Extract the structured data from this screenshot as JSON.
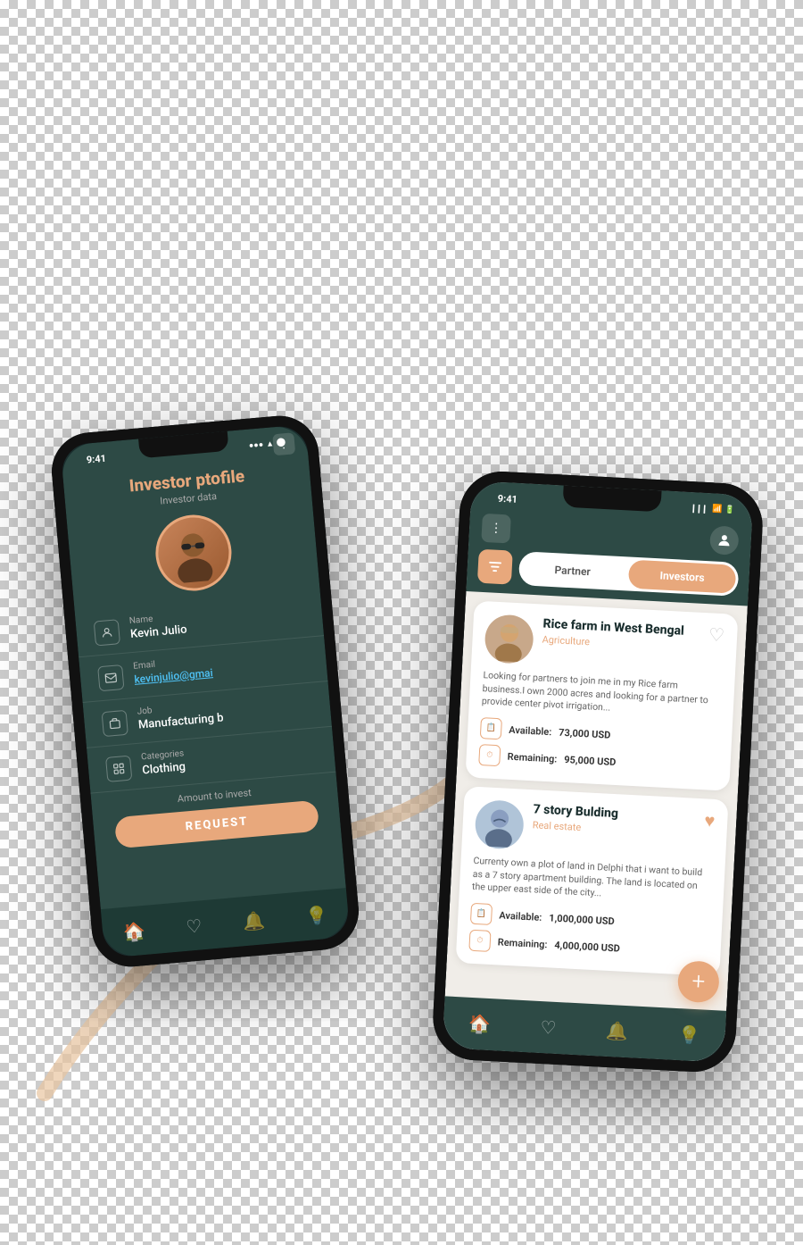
{
  "background": "checkered",
  "swirl": {
    "color": "#e8c4a0"
  },
  "phone_back": {
    "time": "9:41",
    "title": "Investor ptofile",
    "subtitle": "Investor data",
    "fields": [
      {
        "id": "name",
        "label": "Name",
        "value": "Kevin Julio"
      },
      {
        "id": "email",
        "label": "Email",
        "value": "kevinjulio@gmai"
      },
      {
        "id": "job",
        "label": "Job",
        "value": "Manufacturing b"
      },
      {
        "id": "categories",
        "label": "Categories",
        "value": "Clothing"
      }
    ],
    "amount_label": "Amount to invest",
    "request_btn": "REQUEST",
    "nav": [
      "home",
      "heart",
      "bell",
      "bulb"
    ]
  },
  "phone_front": {
    "time": "9:41",
    "tabs": [
      {
        "id": "partner",
        "label": "Partner",
        "active": false
      },
      {
        "id": "investors",
        "label": "Investors",
        "active": true
      }
    ],
    "cards": [
      {
        "id": "card1",
        "title": "Rice farm in West Bengal",
        "category": "Agriculture",
        "description": "Looking for partners to join me in my Rice farm business.I own 2000 acres and looking for a partner to provide center pivot irrigation...",
        "available": "73,000 USD",
        "remaining": "95,000 USD",
        "liked": false
      },
      {
        "id": "card2",
        "title": "7 story Bulding",
        "category": "Real estate",
        "description": "Currenty own a plot of land in Delphi that i want to build as a 7 story apartment building. The land is located on the upper east side of the city...",
        "available": "1,000,000 USD",
        "remaining": "4,000,000 USD",
        "liked": true
      }
    ],
    "fab_label": "+",
    "nav": [
      "home",
      "heart",
      "bell",
      "bulb"
    ]
  }
}
